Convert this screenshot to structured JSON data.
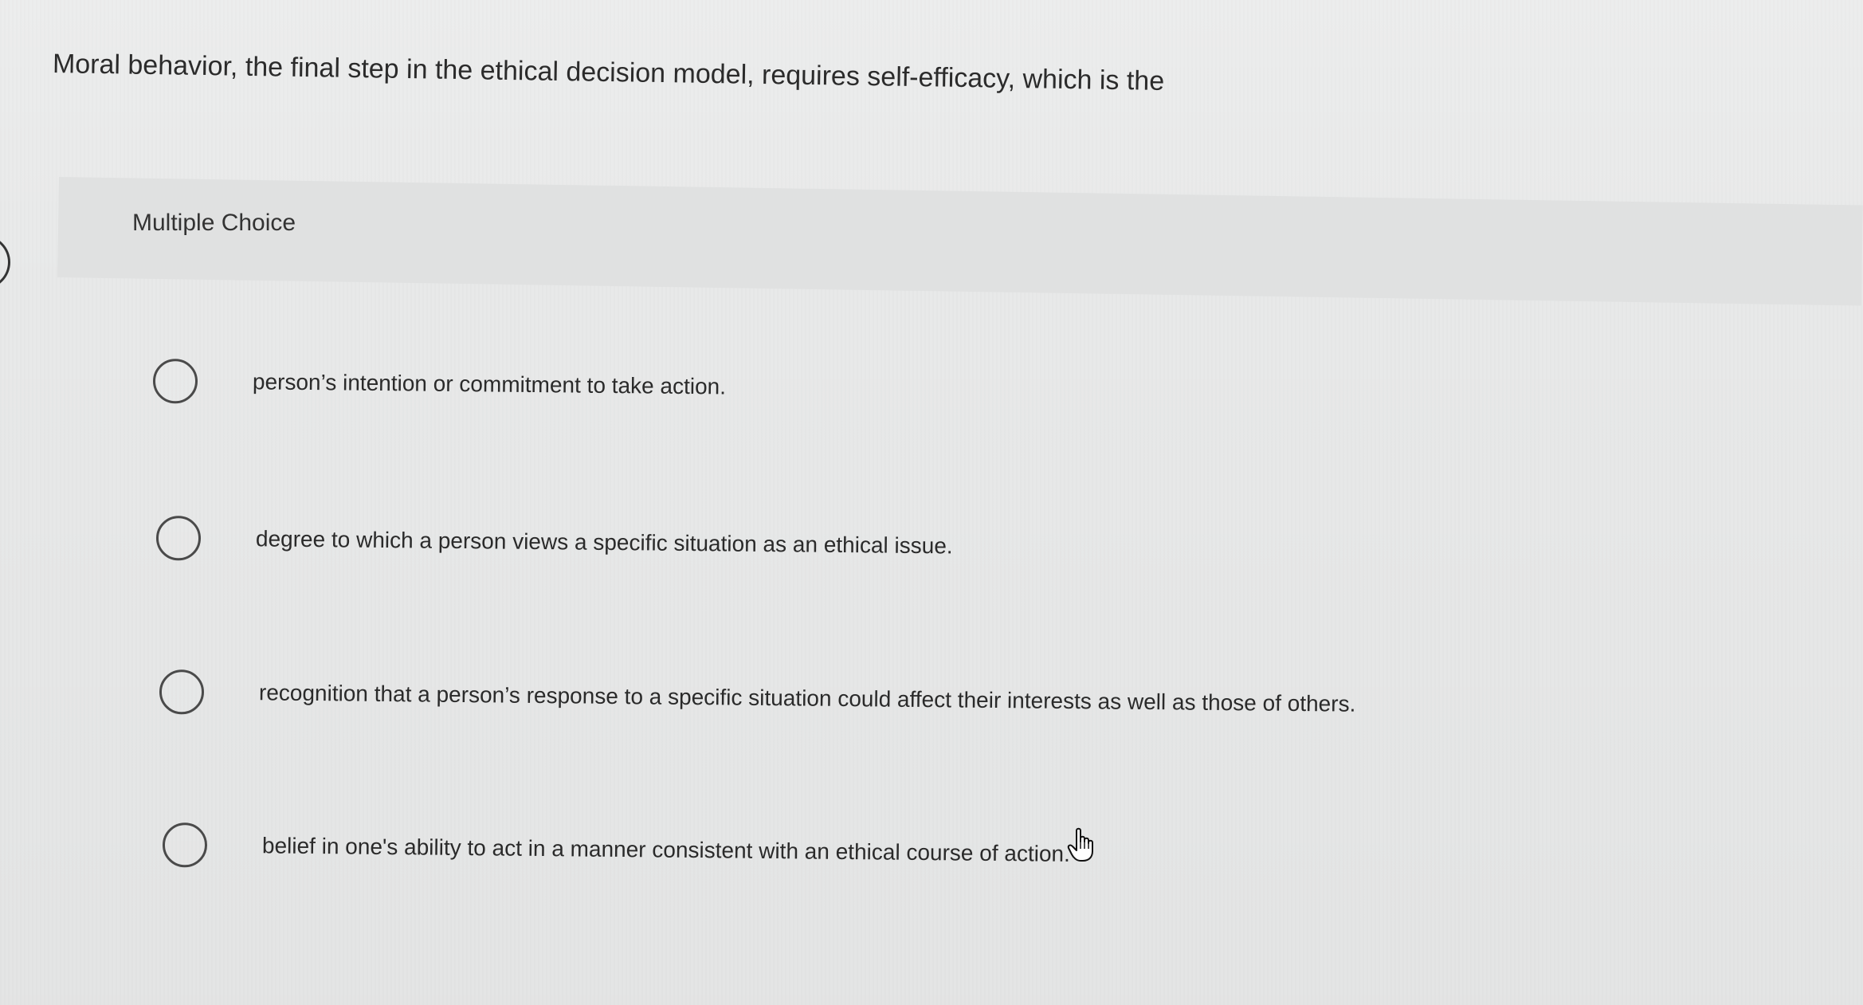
{
  "question": {
    "text": "Moral behavior, the final step in the ethical decision model, requires self-efficacy, which is the"
  },
  "section": {
    "label": "Multiple Choice"
  },
  "options": [
    {
      "label": "person’s intention or commitment to take action."
    },
    {
      "label": "degree to which a person views a specific situation as an ethical issue."
    },
    {
      "label": "recognition that a person’s response to a specific situation could affect their interests as well as those of others."
    },
    {
      "label": "belief in one's ability to act in a manner consistent with an ethical course of action."
    }
  ],
  "icons": {
    "radio": "radio-button-icon",
    "cursor": "hand-pointer-icon"
  }
}
